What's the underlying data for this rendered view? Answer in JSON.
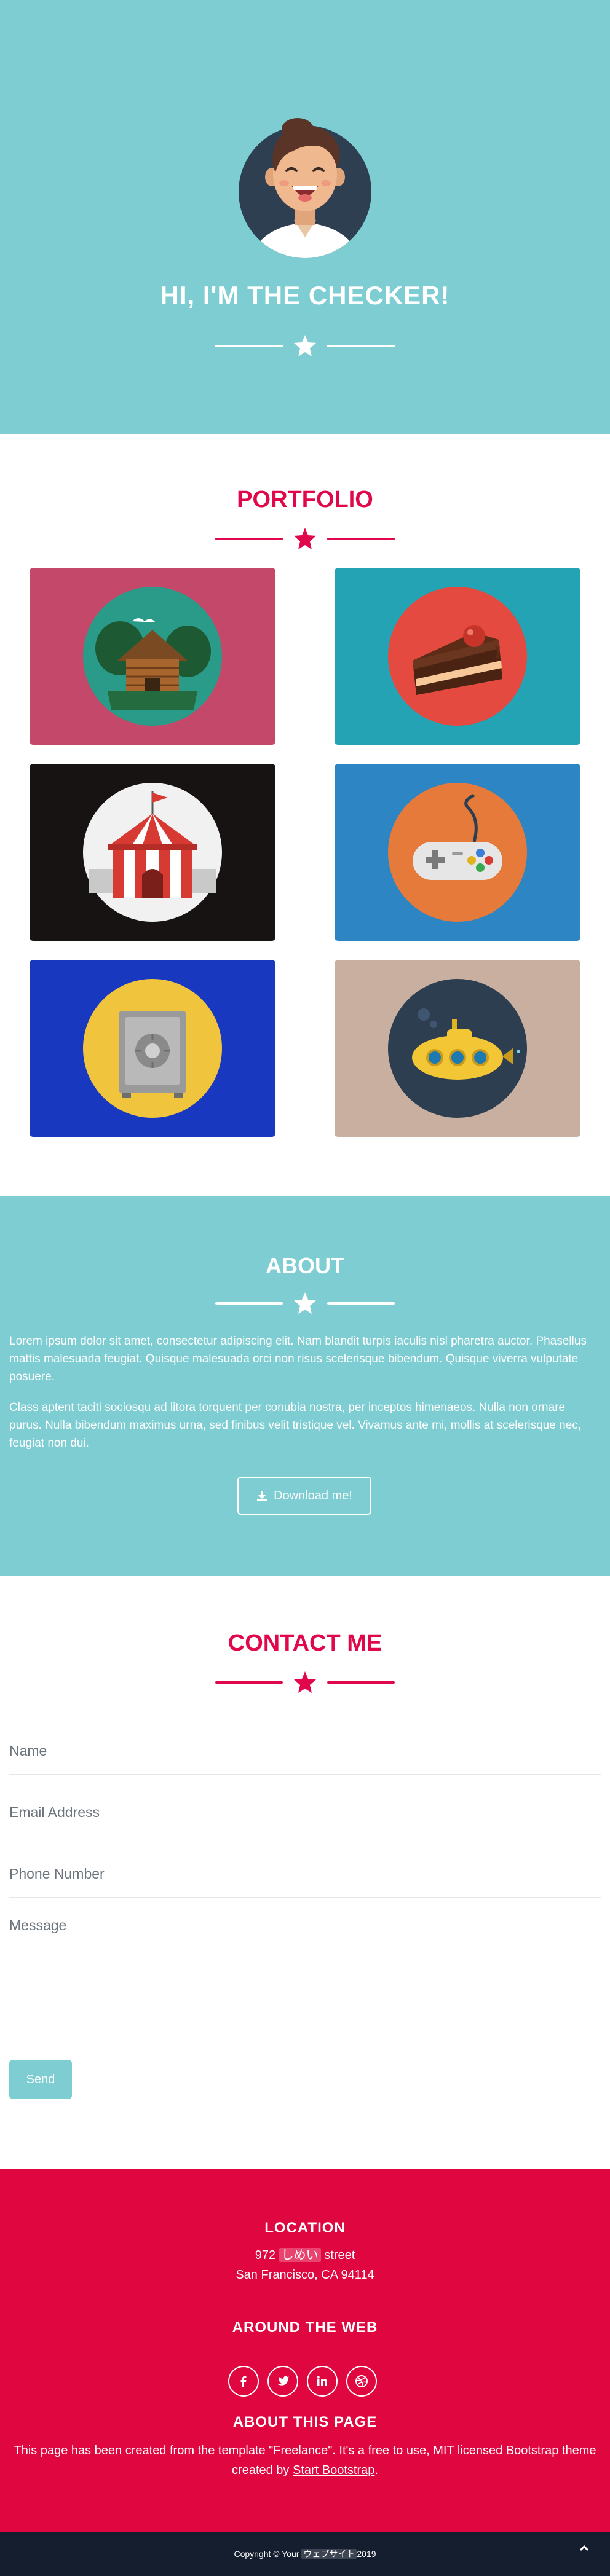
{
  "colors": {
    "teal": "#7dcdd3",
    "crimson": "#e0084b",
    "footer_red": "#e0063f",
    "copyright_bg": "#141e2e"
  },
  "hero": {
    "title": "HI, I'M THE CHECKER!",
    "avatar_icon": "smiling-man-avatar",
    "divider_icon": "star-icon"
  },
  "portfolio": {
    "title": "PORTFOLIO",
    "items": [
      {
        "icon": "log-cabin-icon",
        "bg": "#c3486a"
      },
      {
        "icon": "cake-slice-icon",
        "bg": "#24a3b5"
      },
      {
        "icon": "circus-tent-icon",
        "bg": "#161312"
      },
      {
        "icon": "game-controller-icon",
        "bg": "#2d85c4"
      },
      {
        "icon": "safe-icon",
        "bg": "#1838c0"
      },
      {
        "icon": "submarine-icon",
        "bg": "#c8afa0"
      }
    ]
  },
  "about": {
    "title": "ABOUT",
    "paragraphs": [
      "Lorem ipsum dolor sit amet, consectetur adipiscing elit. Nam blandit turpis iaculis nisl pharetra auctor. Phasellus mattis malesuada feugiat. Quisque malesuada orci non risus scelerisque bibendum. Quisque viverra vulputate posuere.",
      "Class aptent taciti sociosqu ad litora torquent per conubia nostra, per inceptos himenaeos. Nulla non ornare purus. Nulla bibendum maximus urna, sed finibus velit tristique vel. Vivamus ante mi, mollis at scelerisque nec, feugiat non dui."
    ],
    "download_label": "Download me!",
    "download_icon": "download-icon"
  },
  "contact": {
    "title": "CONTACT ME",
    "name_placeholder": "Name",
    "email_placeholder": "Email Address",
    "phone_placeholder": "Phone Number",
    "message_placeholder": "Message",
    "send_label": "Send"
  },
  "footer": {
    "location_heading": "LOCATION",
    "address_prefix": "972 ",
    "address_jp": "しめい",
    "address_suffix": " street",
    "address_line2": "San Francisco, CA 94114",
    "web_heading": "AROUND THE WEB",
    "social": [
      "facebook-icon",
      "twitter-icon",
      "linkedin-icon",
      "dribbble-icon"
    ],
    "about_heading": "ABOUT THIS PAGE",
    "about_line1": "This page has been created from the template \"Freelance\". It's a free to use, MIT licensed Bootstrap theme",
    "about_line2_prefix": "created by ",
    "about_link": "Start Bootstrap",
    "about_line2_suffix": "."
  },
  "copyright": {
    "prefix": "Copyright © Your ",
    "jp": "ウェブサイト",
    "suffix": "2019"
  }
}
